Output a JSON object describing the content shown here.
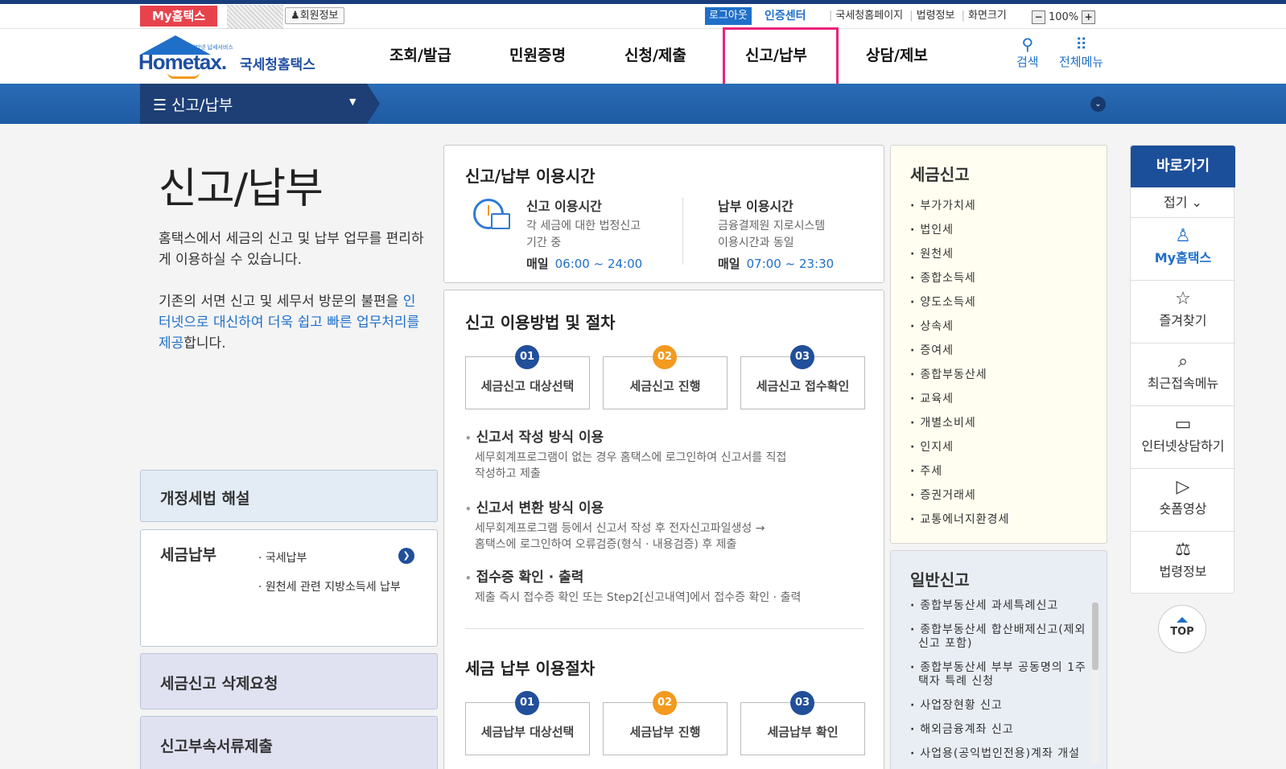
{
  "utility": {
    "my_hometax": "My홈택스",
    "member_info": "회원정보",
    "logout": "로그아웃",
    "cert_center": "인증센터",
    "links": [
      "국세청홈페이지",
      "법령정보",
      "화면크기"
    ],
    "zoom_minus": "−",
    "zoom_value": "100%",
    "zoom_plus": "+"
  },
  "logo": {
    "tagline": "인터넷 납세서비스",
    "wordmark": "Hometax.",
    "korean_name": "국세청홈택스"
  },
  "gnb": {
    "items": [
      "조회/발급",
      "민원증명",
      "신청/제출",
      "신고/납부",
      "상담/제보"
    ],
    "active": "신고/납부",
    "search_label": "검색",
    "all_menu_label": "전체메뉴",
    "search_icon": "search-icon",
    "grid_icon": "grid-icon"
  },
  "subnav": {
    "title": "신고/납부",
    "menu_icon": "☰",
    "caret": "▼",
    "circle": "⌄"
  },
  "intro": {
    "title": "신고/납부",
    "para1": "홈택스에서 세금의 신고 및 납부 업무를 편리하게 이용하실 수 있습니다.",
    "para2_a": "기존의 서면 신고 및 세무서 방문의 불편을 ",
    "para2_hl": "인터넷으로 대신하여 더욱 쉽고 빠른 업무처리를 제공",
    "para2_b": "합니다."
  },
  "left_boxes": {
    "revised_tax_law": "개정세법 해설",
    "tax_payment": "세금납부",
    "payment_items": [
      "국세납부",
      "원천세 관련 지방소득세 납부"
    ],
    "delete_request": "세금신고 삭제요청",
    "attach_docs": "신고부속서류제출"
  },
  "usage_time": {
    "title": "신고/납부 이용시간",
    "report": {
      "heading": "신고 이용시간",
      "desc1": "각 세금에 대한 법정신고",
      "desc2": "기간 중",
      "daily": "매일",
      "time": "06:00 ~ 24:00"
    },
    "payment": {
      "heading": "납부 이용시간",
      "desc1": "금융결제원 지로시스템",
      "desc2": "이용시간과 동일",
      "daily": "매일",
      "time": "07:00 ~ 23:30"
    }
  },
  "procedure": {
    "title": "신고 이용방법 및 절차",
    "steps": [
      {
        "num": "01",
        "label": "세금신고 대상선택"
      },
      {
        "num": "02",
        "label": "세금신고 진행"
      },
      {
        "num": "03",
        "label": "세금신고 접수확인"
      }
    ],
    "bullets": [
      {
        "heading": "신고서 작성 방식 이용",
        "desc1": "세무회계프로그램이 없는 경우 홈택스에 로그인하여 신고서를 직접",
        "desc2": "작성하고 제출"
      },
      {
        "heading": "신고서 변환 방식 이용",
        "desc1": "세무회계프로그램 등에서 신고서 작성 후 전자신고파일생성 →",
        "desc2": "홈택스에 로그인하여 오류검증(형식 · 내용검증) 후 제출"
      },
      {
        "heading": "접수증 확인 · 출력",
        "desc1": "제출 즉시 접수증 확인 또는 Step2[신고내역]에서 접수증 확인 · 출력",
        "desc2": ""
      }
    ],
    "pay_title": "세금 납부 이용절차",
    "pay_steps": [
      {
        "num": "01",
        "label": "세금납부 대상선택"
      },
      {
        "num": "02",
        "label": "세금납부 진행"
      },
      {
        "num": "03",
        "label": "세금납부 확인"
      }
    ]
  },
  "tax_report": {
    "title": "세금신고",
    "items": [
      "부가가치세",
      "법인세",
      "원천세",
      "종합소득세",
      "양도소득세",
      "상속세",
      "증여세",
      "종합부동산세",
      "교육세",
      "개별소비세",
      "인지세",
      "주세",
      "증권거래세",
      "교통에너지환경세"
    ]
  },
  "general_report": {
    "title": "일반신고",
    "items": [
      "종합부동산세 과세특례신고",
      "종합부동산세 합산배제신고(제외신고 포함)",
      "종합부동산세 부부 공동명의 1주택자 특례 신청",
      "사업장현황 신고",
      "해외금융계좌 신고",
      "사업용(공익법인전용)계좌 개설"
    ]
  },
  "quick": {
    "title": "바로가기",
    "fold": "접기 ⌄",
    "items": [
      {
        "icon": "person-icon",
        "glyph": "♙",
        "label": "My홈택스"
      },
      {
        "icon": "star-icon",
        "glyph": "☆",
        "label": "즐겨찾기"
      },
      {
        "icon": "recent-menu-icon",
        "glyph": "⌕",
        "label": "최근접속메뉴"
      },
      {
        "icon": "monitor-icon",
        "glyph": "▭",
        "label": "인터넷상담하기"
      },
      {
        "icon": "play-icon",
        "glyph": "▷",
        "label": "숏폼영상"
      },
      {
        "icon": "gavel-icon",
        "glyph": "⚖",
        "label": "법령정보"
      }
    ],
    "top": "TOP"
  }
}
